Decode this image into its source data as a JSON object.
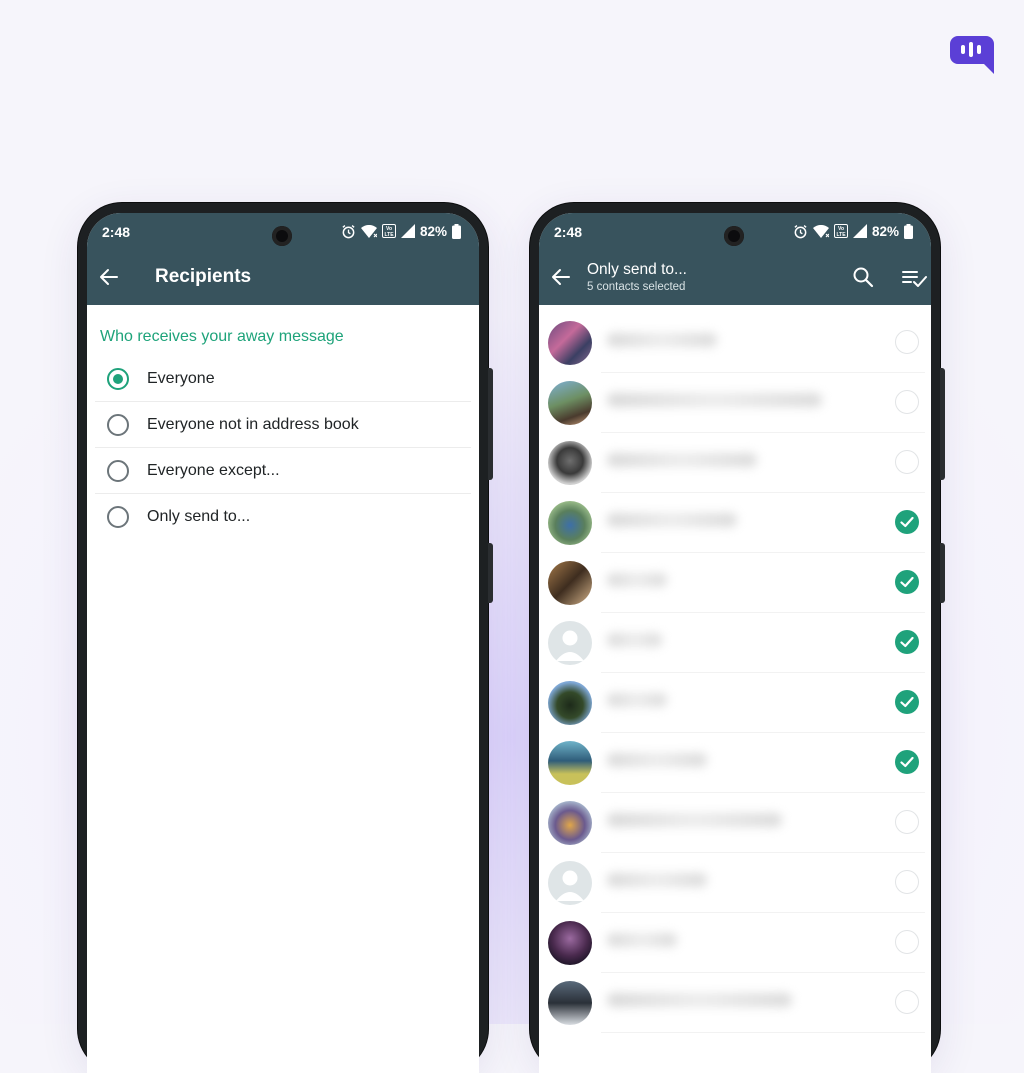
{
  "colors": {
    "header": "#38535d",
    "accent": "#1fa27b",
    "brand": "#5b3fd6"
  },
  "status_bar": {
    "time": "2:48",
    "battery": "82%",
    "icons": [
      "alarm-icon",
      "wifi-icon",
      "volte-icon",
      "signal-icon",
      "battery-icon"
    ]
  },
  "left_screen": {
    "title": "Recipients",
    "section_header": "Who receives your away message",
    "options": [
      {
        "label": "Everyone",
        "selected": true
      },
      {
        "label": "Everyone not in address book",
        "selected": false
      },
      {
        "label": "Everyone except...",
        "selected": false
      },
      {
        "label": "Only send to...",
        "selected": false
      }
    ]
  },
  "right_screen": {
    "title": "Only send to...",
    "subtitle": "5 contacts selected",
    "contacts": [
      {
        "selected": false,
        "avatar": "photo-avatar"
      },
      {
        "selected": false,
        "avatar": "photo-avatar"
      },
      {
        "selected": false,
        "avatar": "photo-avatar"
      },
      {
        "selected": true,
        "avatar": "photo-avatar"
      },
      {
        "selected": true,
        "avatar": "photo-avatar"
      },
      {
        "selected": true,
        "avatar": "default-avatar"
      },
      {
        "selected": true,
        "avatar": "photo-avatar"
      },
      {
        "selected": true,
        "avatar": "photo-avatar"
      },
      {
        "selected": false,
        "avatar": "photo-avatar"
      },
      {
        "selected": false,
        "avatar": "default-avatar"
      },
      {
        "selected": false,
        "avatar": "photo-avatar"
      },
      {
        "selected": false,
        "avatar": "photo-avatar"
      }
    ]
  }
}
